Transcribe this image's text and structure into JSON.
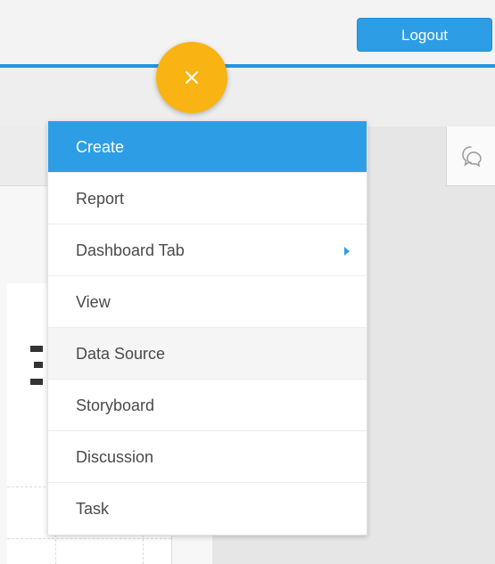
{
  "header": {
    "logout_label": "Logout"
  },
  "colors": {
    "accent": "#1e96e6",
    "fab": "#f9b312",
    "menu_header": "#2d9ee6"
  },
  "fab": {
    "icon": "close-icon"
  },
  "side_tool": {
    "icon": "discussion-icon"
  },
  "menu": {
    "header_label": "Create",
    "items": [
      {
        "label": "Report"
      },
      {
        "label": "Dashboard Tab",
        "has_submenu": true
      },
      {
        "label": "View"
      },
      {
        "label": "Data Source"
      },
      {
        "label": "Storyboard"
      },
      {
        "label": "Discussion"
      },
      {
        "label": "Task"
      }
    ]
  }
}
